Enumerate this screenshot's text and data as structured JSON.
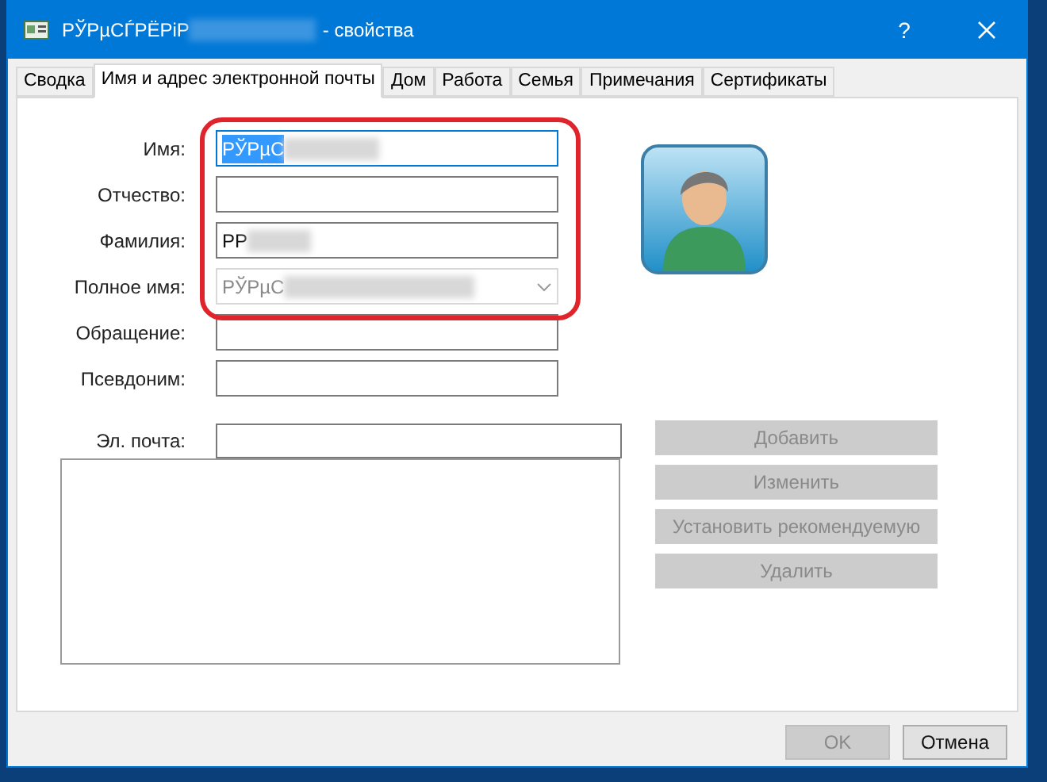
{
  "window": {
    "title": "РЎРµСЃРЁРіР",
    "title_redacted": true,
    "title_suffix": "- свойства",
    "help": "?"
  },
  "tabs": [
    {
      "label": "Сводка",
      "selected": false
    },
    {
      "label": "Имя и адрес электронной почты",
      "selected": true
    },
    {
      "label": "Дом",
      "selected": false
    },
    {
      "label": "Работа",
      "selected": false
    },
    {
      "label": "Семья",
      "selected": false
    },
    {
      "label": "Примечания",
      "selected": false
    },
    {
      "label": "Сертификаты",
      "selected": false
    }
  ],
  "fields": [
    {
      "label": "Имя:",
      "value": "РЎРµС",
      "kind": "text",
      "focused": true,
      "redacted": true
    },
    {
      "label": "Отчество:",
      "kind": "text",
      "focused": false,
      "redacted": false
    },
    {
      "label": "Фамилия:",
      "value": "РР",
      "kind": "text",
      "focused": false,
      "redacted": true
    },
    {
      "label": "Полное имя:",
      "value": "РЎРµС",
      "kind": "combo",
      "focused": false,
      "redacted": true
    },
    {
      "label": "Обращение:",
      "kind": "text",
      "focused": false,
      "redacted": false
    },
    {
      "label": "Псевдоним:",
      "kind": "text",
      "focused": false,
      "redacted": false
    }
  ],
  "email": {
    "label": "Эл. почта:"
  },
  "email_buttons": [
    {
      "label": "Добавить",
      "disabled": true
    },
    {
      "label": "Изменить",
      "disabled": true
    },
    {
      "label": "Установить рекомендуемую",
      "disabled": true
    },
    {
      "label": "Удалить",
      "disabled": true
    }
  ],
  "footer_buttons": [
    {
      "label": "OK",
      "disabled": true
    },
    {
      "label": "Отмена",
      "disabled": false
    }
  ]
}
